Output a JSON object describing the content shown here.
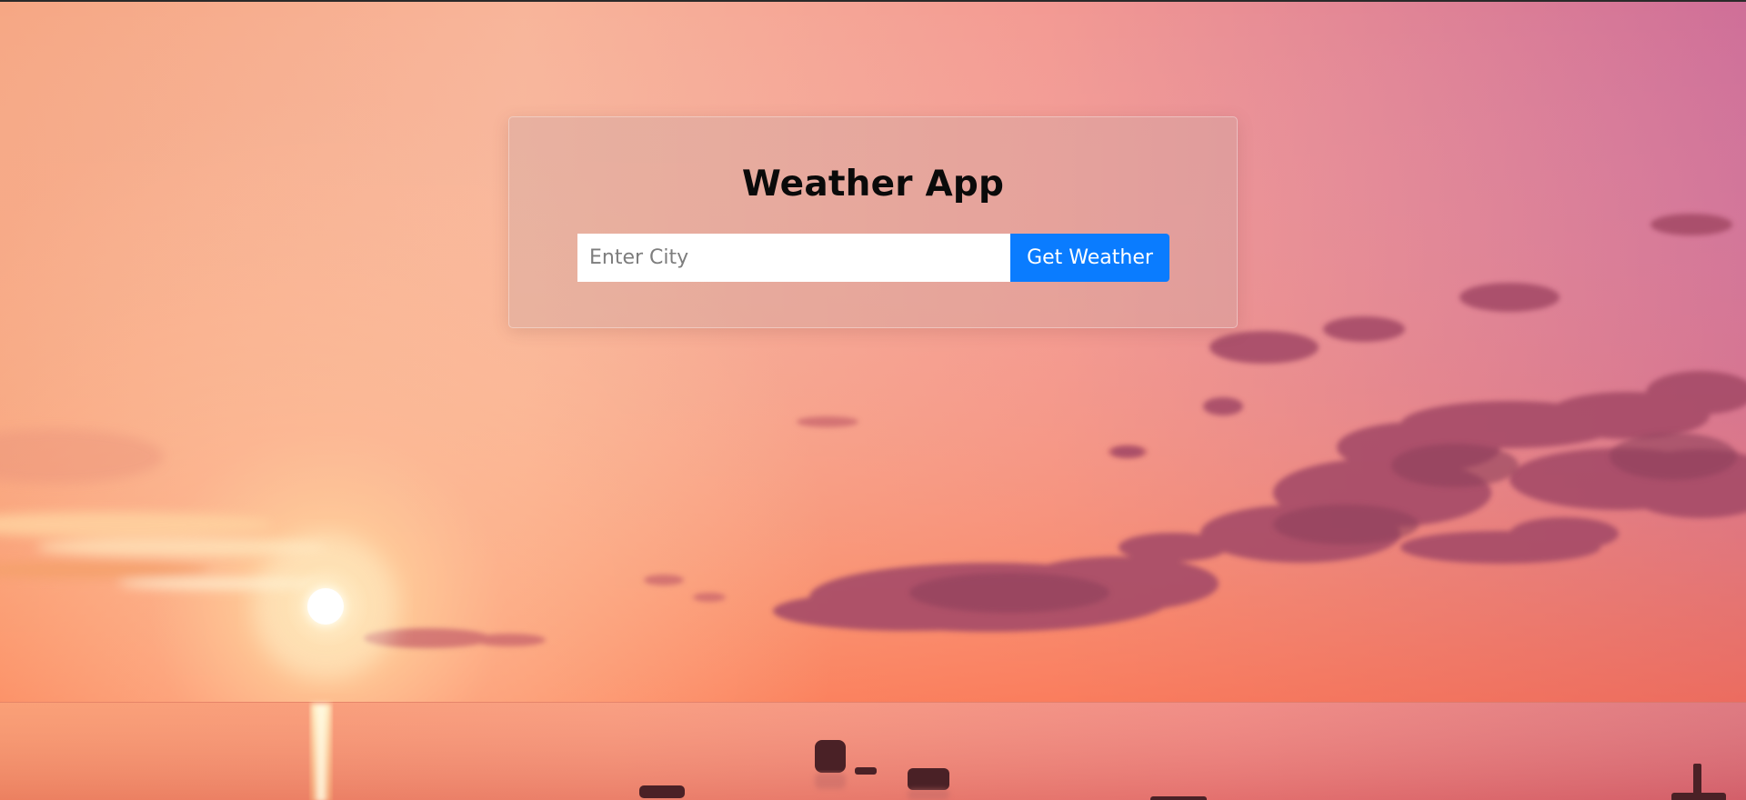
{
  "app": {
    "title": "Weather App"
  },
  "search": {
    "placeholder": "Enter City",
    "value": "",
    "button_label": "Get Weather"
  },
  "theme": {
    "accent": "#0a7cff",
    "card_tint": "rgba(210,170,165,0.42)",
    "title_color": "#0a0a0a"
  },
  "background": {
    "description_icon": "sunset-sea-background"
  }
}
